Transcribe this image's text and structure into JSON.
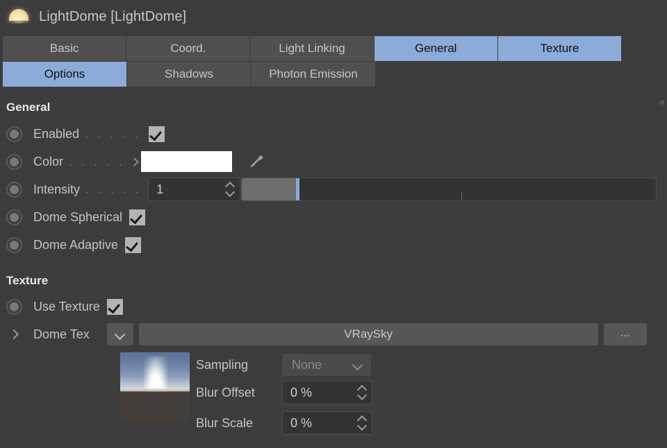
{
  "window": {
    "icon": "dome-light-icon",
    "title": "LightDome [LightDome]"
  },
  "tabs": {
    "row1": [
      {
        "label": "Basic",
        "active": false
      },
      {
        "label": "Coord.",
        "active": false
      },
      {
        "label": "Light Linking",
        "active": false
      },
      {
        "label": "General",
        "active": true
      },
      {
        "label": "Texture",
        "active": true
      }
    ],
    "row2": [
      {
        "label": "Options",
        "active": true
      },
      {
        "label": "Shadows",
        "active": false
      },
      {
        "label": "Photon Emission",
        "active": false
      }
    ]
  },
  "general": {
    "heading": "General",
    "enabled": {
      "label": "Enabled",
      "dots": ". . . . .",
      "checked": true
    },
    "color": {
      "label": "Color",
      "dots": ". . . . .",
      "value": "#ffffff",
      "picker_icon": "eyedropper-icon"
    },
    "intensity": {
      "label": "Intensity",
      "dots": ". . . . .",
      "value": "1",
      "slider_percent": 15,
      "tick_percent": 44
    },
    "dome_spherical": {
      "label": "Dome Spherical",
      "checked": true
    },
    "dome_adaptive": {
      "label": "Dome Adaptive",
      "checked": true
    }
  },
  "texture": {
    "heading": "Texture",
    "use_texture": {
      "label": "Use Texture",
      "checked": true
    },
    "dome_tex": {
      "label": "Dome Tex",
      "dropdown_icon": "chevron-down-icon",
      "value": "VRaySky",
      "more_button": "..."
    },
    "preview": {
      "name": "texture-preview-thumbnail"
    },
    "sampling": {
      "label": "Sampling",
      "value": "None",
      "disabled": true
    },
    "blur_offset": {
      "label": "Blur Offset",
      "value": "0 %"
    },
    "blur_scale": {
      "label": "Blur Scale",
      "value": "0 %"
    }
  },
  "colors": {
    "background": "#3c3c3c",
    "tab_inactive": "#4f4f4f",
    "tab_active": "#8cabd9",
    "field_bg": "#333333",
    "checkbox": "#b4b4b4"
  }
}
